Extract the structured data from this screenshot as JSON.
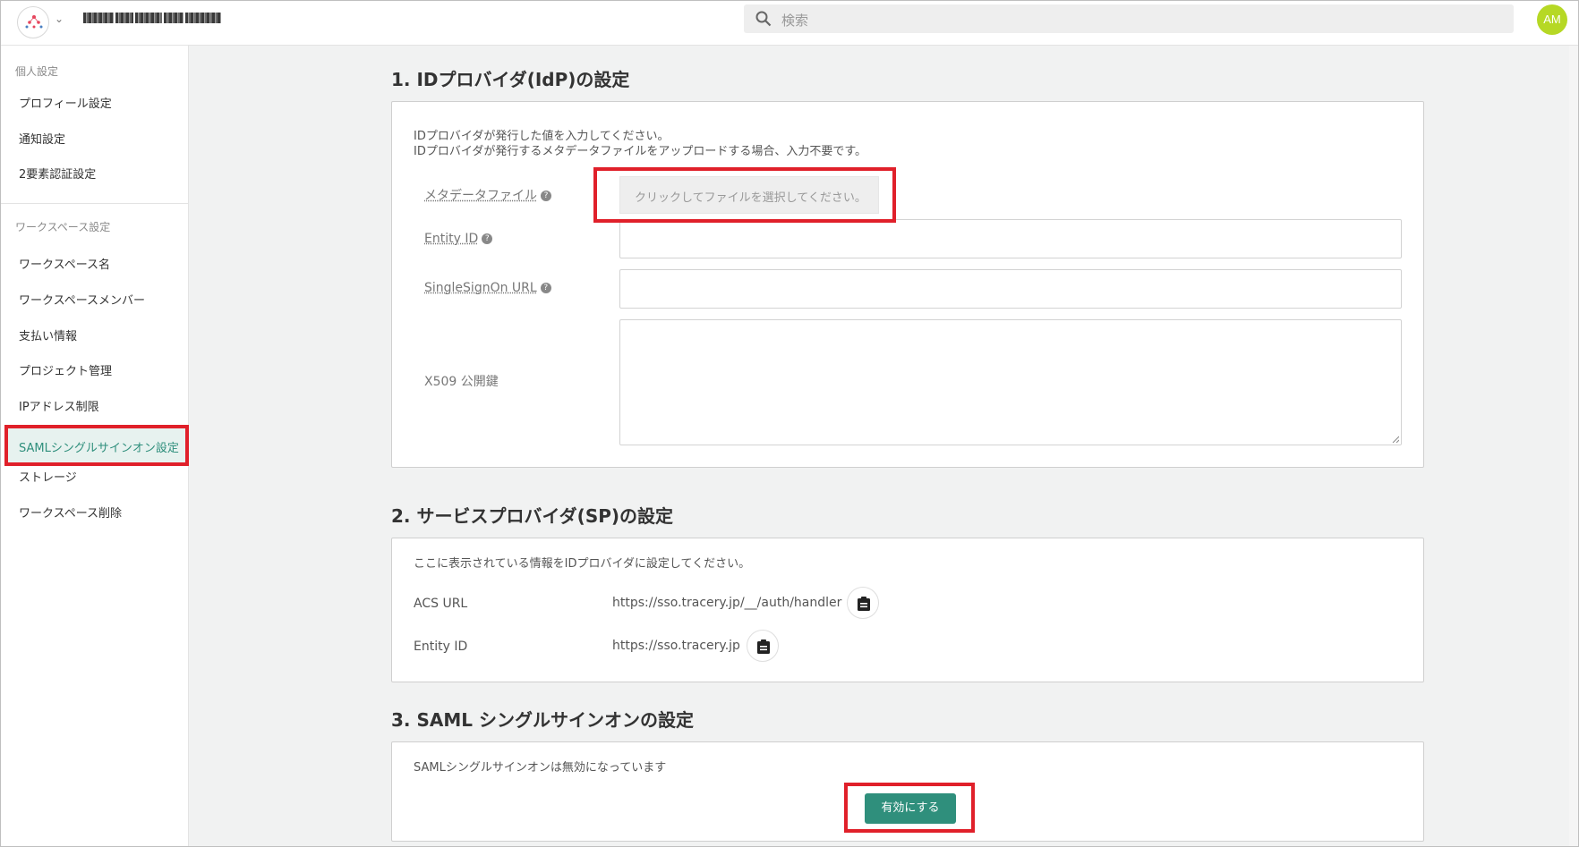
{
  "header": {
    "search_placeholder": "検索",
    "avatar_initials": "AM"
  },
  "sidebar": {
    "personal_title": "個人設定",
    "personal_items": [
      "プロフィール設定",
      "通知設定",
      "2要素認証設定"
    ],
    "workspace_title": "ワークスペース設定",
    "workspace_items": [
      "ワークスペース名",
      "ワークスペースメンバー",
      "支払い情報",
      "プロジェクト管理",
      "IPアドレス制限"
    ],
    "active_item": "SAMLシングルサインオン設定",
    "workspace_items_after": [
      "ストレージ",
      "ワークスペース削除"
    ]
  },
  "section1": {
    "title": "1. IDプロバイダ(IdP)の設定",
    "desc_line1": "IDプロバイダが発行した値を入力してください。",
    "desc_line2": "IDプロバイダが発行するメタデータファイルをアップロードする場合、入力不要です。",
    "metadata_label": "メタデータファイル",
    "metadata_button": "クリックしてファイルを選択してください。",
    "entity_id_label": "Entity ID",
    "sso_url_label": "SingleSignOn URL",
    "x509_label": "X509 公開鍵",
    "entity_id_value": "",
    "sso_url_value": "",
    "x509_value": ""
  },
  "section2": {
    "title": "2. サービスプロバイダ(SP)の設定",
    "desc": "ここに表示されている情報をIDプロバイダに設定してください。",
    "acs_url_label": "ACS URL",
    "acs_url_value": "https://sso.tracery.jp/__/auth/handler",
    "entity_id_label": "Entity ID",
    "entity_id_value": "https://sso.tracery.jp"
  },
  "section3": {
    "title": "3. SAML シングルサインオンの設定",
    "status": "SAMLシングルサインオンは無効になっています",
    "enable_button": "有効にする"
  },
  "colors": {
    "accent": "#2f8f7c",
    "highlight": "#e0202a",
    "avatar": "#b6d825"
  }
}
